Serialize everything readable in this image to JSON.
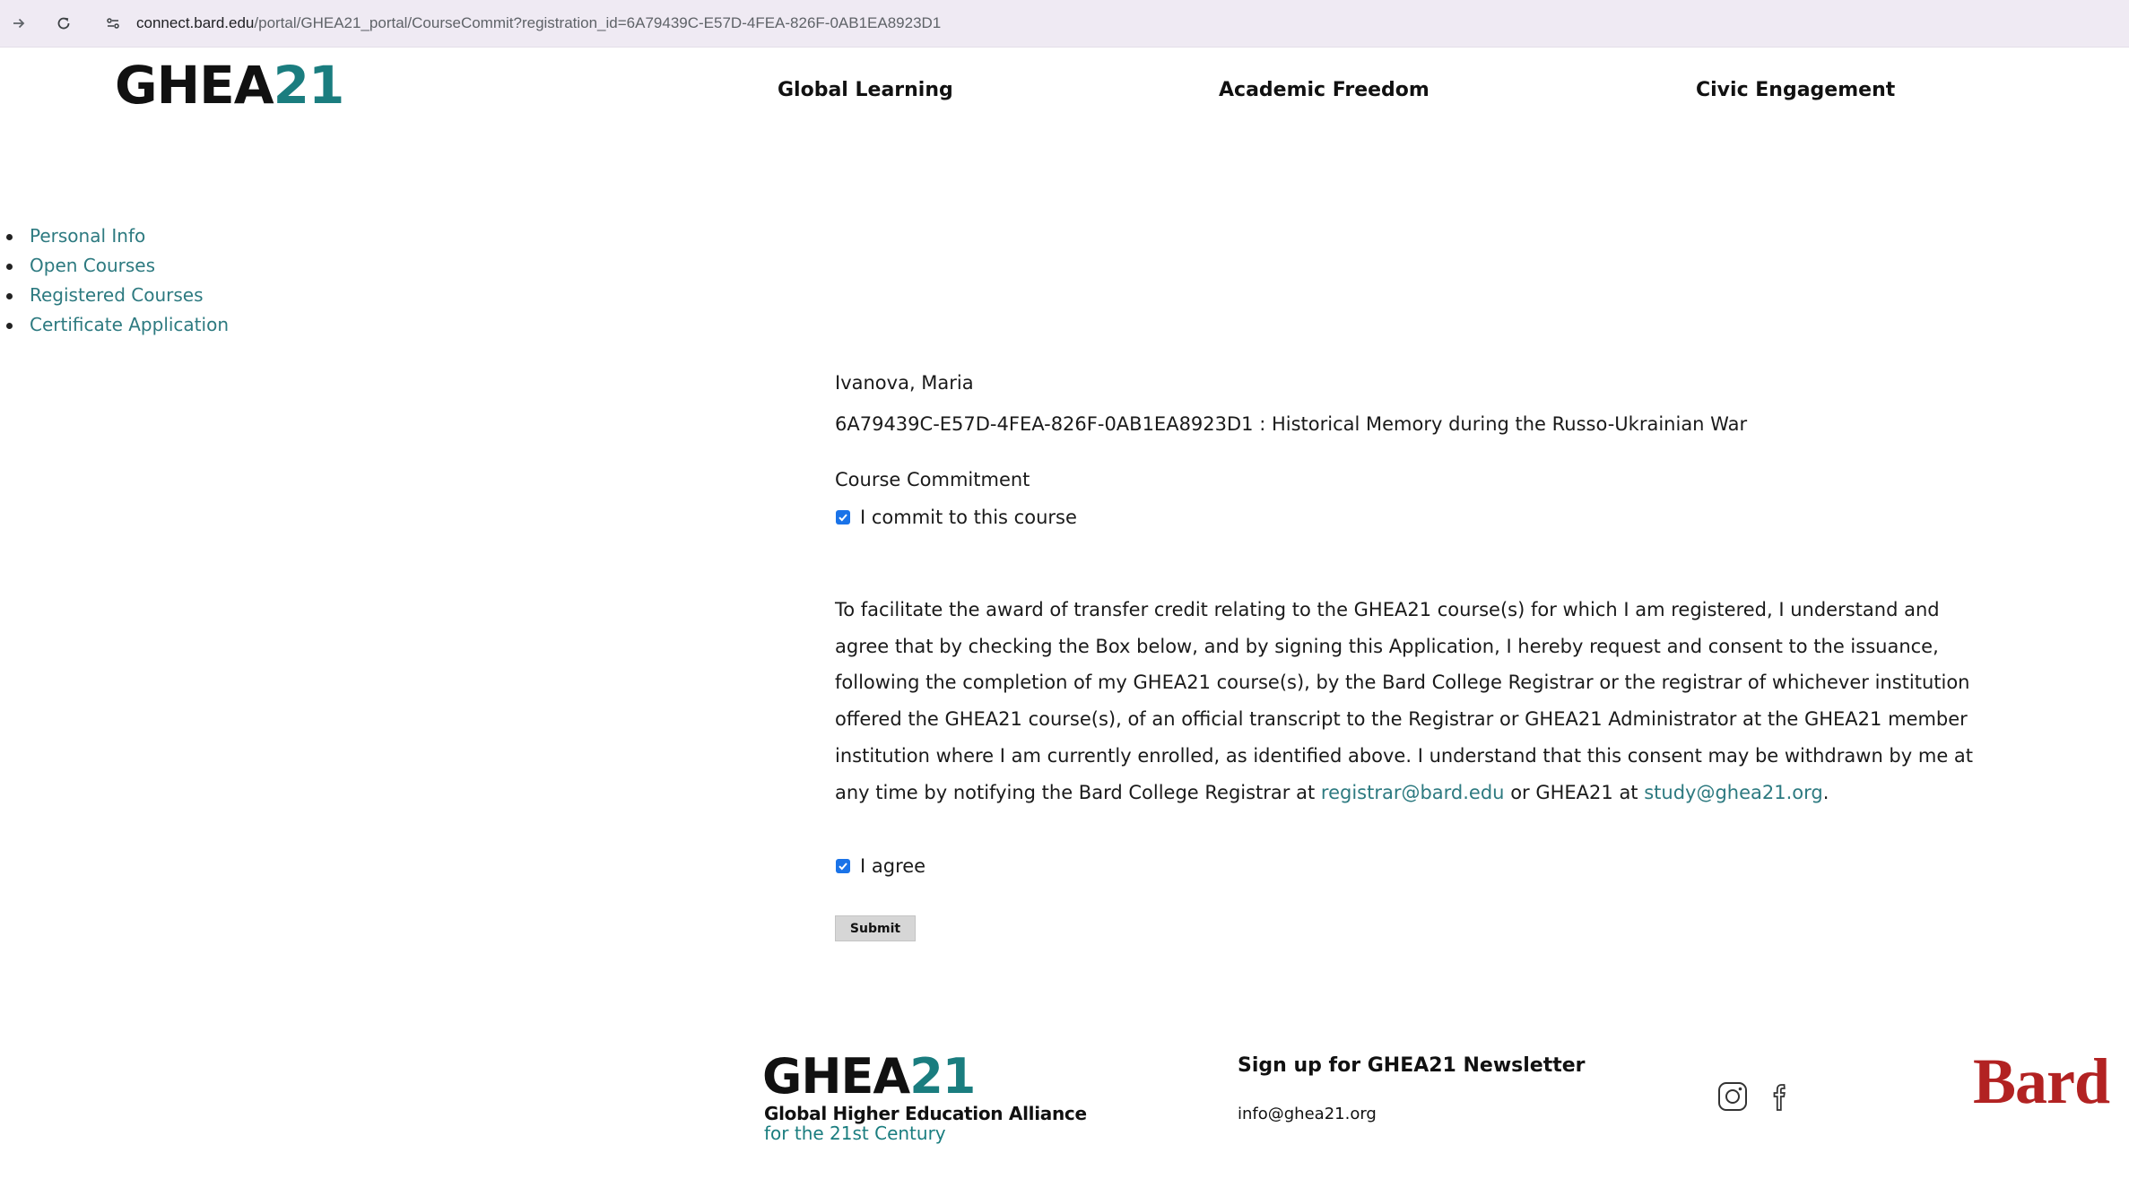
{
  "browser": {
    "url_host": "connect.bard.edu",
    "url_path": "/portal/GHEA21_portal/CourseCommit?registration_id=6A79439C-E57D-4FEA-826F-0AB1EA8923D1",
    "icons": [
      "forward-icon",
      "reload-icon",
      "site-info-icon"
    ]
  },
  "header": {
    "logo_main": "GHEA",
    "logo_accent": "21",
    "nav": [
      {
        "label": "Global Learning"
      },
      {
        "label": "Academic Freedom"
      },
      {
        "label": "Civic Engagement"
      }
    ]
  },
  "sidebar": {
    "items": [
      {
        "label": "Personal Info"
      },
      {
        "label": "Open Courses"
      },
      {
        "label": "Registered Courses"
      },
      {
        "label": "Certificate Application"
      }
    ]
  },
  "main": {
    "student_name": "Ivanova, Maria",
    "course_line": "6A79439C-E57D-4FEA-826F-0AB1EA8923D1 : Historical Memory during the Russo-Ukrainian War",
    "commitment_title": "Course Commitment",
    "commit_checkbox": {
      "label": "I commit to this course",
      "checked": true
    },
    "consent_text": "To facilitate the award of transfer credit relating to the GHEA21 course(s) for which I am registered, I understand and agree that by checking the Box below, and by signing this Application, I hereby request and consent to the issuance, following the completion of my GHEA21 course(s), by the Bard College Registrar or the registrar of whichever institution offered the GHEA21 course(s), of an official transcript to the Registrar or GHEA21 Administrator at the GHEA21 member institution where I am currently enrolled, as identified above.  I understand that this consent may be withdrawn by me at any time by notifying the Bard College Registrar at",
    "registrar_email": "registrar@bard.edu",
    "consent_mid": "or GHEA21 at",
    "study_email": "study@ghea21.org",
    "consent_end": ".",
    "agree_checkbox": {
      "label": "I agree",
      "checked": true
    },
    "submit_label": "Submit"
  },
  "footer": {
    "logo_main": "GHEA",
    "logo_accent": "21",
    "tagline_1": "Global Higher Education Alliance",
    "tagline_2": "for the 21st Century",
    "newsletter_title": "Sign up for GHEA21 Newsletter",
    "contact_email": "info@ghea21.org",
    "social_icons": [
      "instagram-icon",
      "facebook-icon"
    ],
    "partner_logo": "Bard",
    "colors": {
      "accent": "#1a7d7f",
      "link": "#2d7a80",
      "bard_red": "#b22222",
      "checkbox": "#1a73e8"
    }
  }
}
